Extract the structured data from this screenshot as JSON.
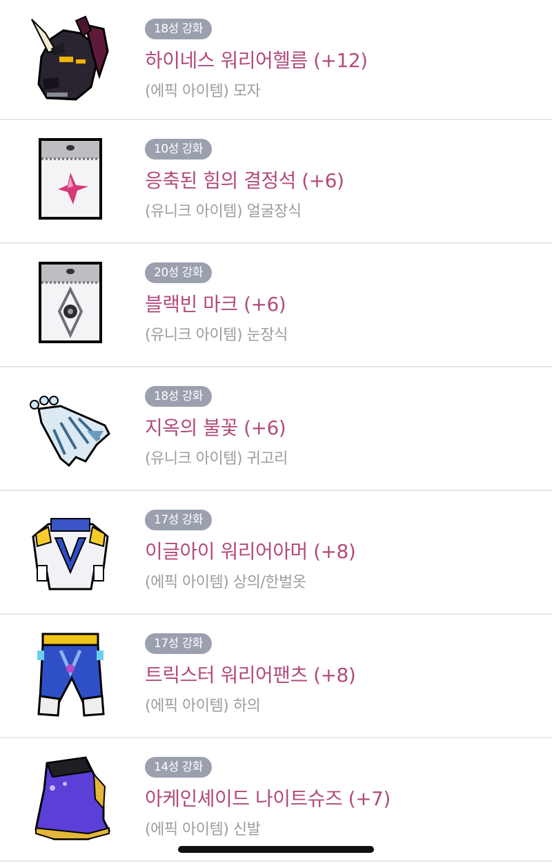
{
  "items": [
    {
      "badge": "18성 강화",
      "name": "하이네스 워리어헬름 (+12)",
      "type": "(에픽 아이템) 모자",
      "icon": "helmet-icon"
    },
    {
      "badge": "10성 강화",
      "name": "응축된 힘의 결정석 (+6)",
      "type": "(유니크 아이템) 얼굴장식",
      "icon": "crystal-face-icon"
    },
    {
      "badge": "20성 강화",
      "name": "블랙빈 마크 (+6)",
      "type": "(유니크 아이템) 눈장식",
      "icon": "eye-mark-icon"
    },
    {
      "badge": "18성 강화",
      "name": "지옥의 불꽃 (+6)",
      "type": "(유니크 아이템) 귀고리",
      "icon": "earring-icon"
    },
    {
      "badge": "17성 강화",
      "name": "이글아이 워리어아머 (+8)",
      "type": "(에픽 아이템) 상의/한벌옷",
      "icon": "armor-icon"
    },
    {
      "badge": "17성 강화",
      "name": "트릭스터 워리어팬츠 (+8)",
      "type": "(에픽 아이템) 하의",
      "icon": "pants-icon"
    },
    {
      "badge": "14성 강화",
      "name": "아케인셰이드 나이트슈즈 (+7)",
      "type": "(에픽 아이템) 신발",
      "icon": "shoes-icon"
    }
  ],
  "colors": {
    "badge_bg": "#9aa0ad",
    "name": "#b24a7c",
    "type": "#9d9d9d",
    "divider": "#e6e6ea"
  }
}
